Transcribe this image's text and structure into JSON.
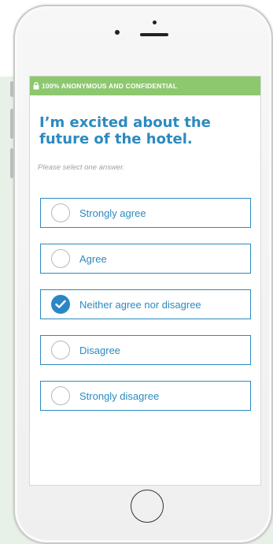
{
  "banner": {
    "text": "100% ANONYMOUS AND CONFIDENTIAL",
    "icon": "lock-icon",
    "color": "#8dc86f"
  },
  "question": {
    "title": "I’m excited about the future of the hotel.",
    "hint": "Please select one answer."
  },
  "options": [
    {
      "label": "Strongly agree",
      "selected": false
    },
    {
      "label": "Agree",
      "selected": false
    },
    {
      "label": "Neither agree nor disagree",
      "selected": true
    },
    {
      "label": "Disagree",
      "selected": false
    },
    {
      "label": "Strongly disagree",
      "selected": false
    }
  ],
  "colors": {
    "accent": "#2c8ac0",
    "selected_radio": "#2a87c4",
    "background_panel": "#e8f1e8"
  }
}
